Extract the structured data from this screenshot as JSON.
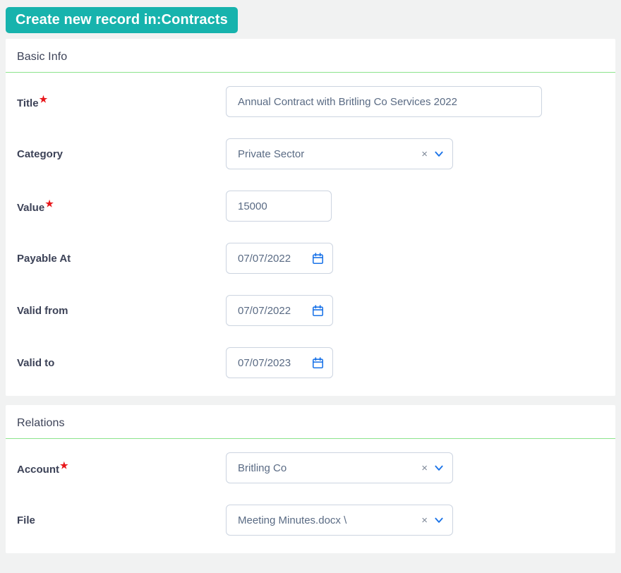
{
  "header": {
    "badge_label": "Create new record in:Contracts",
    "badge_color": "#17b3ad"
  },
  "sections": [
    {
      "title": "Basic Info",
      "fields": [
        {
          "label": "Title",
          "required": true,
          "required_marker": "★",
          "type": "text",
          "value": "Annual Contract with Britling Co Services 2022"
        },
        {
          "label": "Category",
          "required": false,
          "type": "select",
          "value": "Private Sector",
          "clear_label": "×",
          "caret_icon": "chevron-down-icon"
        },
        {
          "label": "Value",
          "required": true,
          "required_marker": "★",
          "type": "text",
          "value": "15000"
        },
        {
          "label": "Payable At",
          "required": false,
          "type": "date",
          "value": "07/07/2022",
          "calendar_icon": "calendar-icon"
        },
        {
          "label": "Valid from",
          "required": false,
          "type": "date",
          "value": "07/07/2022",
          "calendar_icon": "calendar-icon"
        },
        {
          "label": "Valid to",
          "required": false,
          "type": "date",
          "value": "07/07/2023",
          "calendar_icon": "calendar-icon"
        }
      ]
    },
    {
      "title": "Relations",
      "fields": [
        {
          "label": "Account",
          "required": true,
          "required_marker": "★",
          "type": "select",
          "value": "Britling Co",
          "clear_label": "×",
          "caret_icon": "chevron-down-icon"
        },
        {
          "label": "File",
          "required": false,
          "type": "select",
          "value": "Meeting Minutes.docx \\",
          "clear_label": "×",
          "caret_icon": "chevron-down-icon"
        }
      ]
    }
  ],
  "colors": {
    "accent_teal": "#17b3ad",
    "divider_green": "#8ce48c",
    "required_red": "#e8161a",
    "icon_blue": "#1a73e8",
    "input_border": "#ccd4e0",
    "label_text": "#3c4257",
    "value_text": "#5a6b84",
    "page_background": "#f1f2f2"
  }
}
